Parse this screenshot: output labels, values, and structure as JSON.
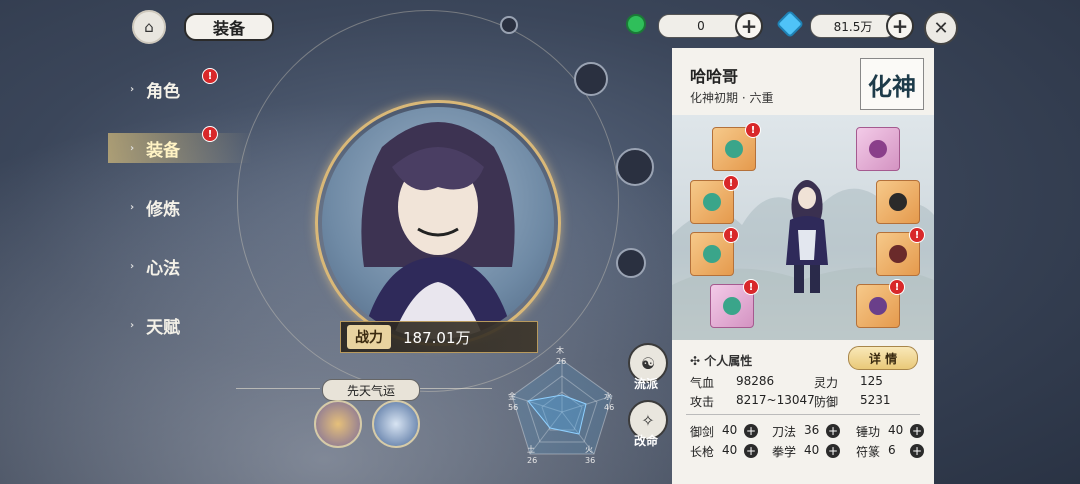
{
  "header": {
    "title": "装备",
    "resource1_value": "0",
    "resource2_value": "81.5万"
  },
  "menu": [
    {
      "label": "角色",
      "badge": "!"
    },
    {
      "label": "装备",
      "badge": "!"
    },
    {
      "label": "修炼"
    },
    {
      "label": "心法"
    },
    {
      "label": "天赋"
    }
  ],
  "portrait": {
    "power_label": "战力",
    "power_value": "187.01万"
  },
  "fortune": {
    "title": "先天气运"
  },
  "radar": {
    "labels": [
      "木",
      "水",
      "火",
      "土",
      "金"
    ],
    "values": [
      "26",
      "46",
      "36",
      "26",
      "56"
    ]
  },
  "side_buttons": {
    "school": "流派",
    "change_fate": "改命"
  },
  "character": {
    "name": "哈哈哥",
    "realm": "化神初期 · 六重",
    "realm_badge": "化神",
    "equip_badge": "!"
  },
  "stats": {
    "heading": "个人属性",
    "detail_button": "详 情",
    "hp_label": "气血",
    "hp_value": "98286",
    "spirit_label": "灵力",
    "spirit_value": "125",
    "atk_label": "攻击",
    "atk_value": "8217~13047",
    "def_label": "防御",
    "def_value": "5231"
  },
  "skills": [
    {
      "label": "御剑",
      "value": "40"
    },
    {
      "label": "刀法",
      "value": "36"
    },
    {
      "label": "锤功",
      "value": "40"
    },
    {
      "label": "长枪",
      "value": "40"
    },
    {
      "label": "拳学",
      "value": "40"
    },
    {
      "label": "符篆",
      "value": "6"
    }
  ],
  "colors": {
    "accent_gold": "#d9b878",
    "badge_red": "#d8282a",
    "radar_blue": "#4ea6e6"
  }
}
